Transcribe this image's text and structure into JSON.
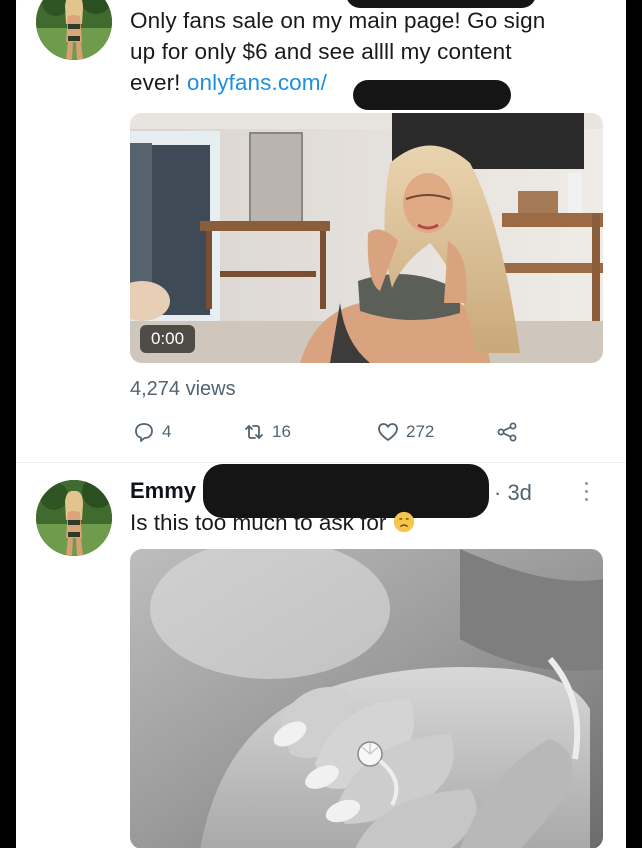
{
  "tweet1": {
    "text_line1": "Only fans sale on my main page! Go sign",
    "text_line2": "up for only $6 and see allll my content",
    "text_line3_prefix": "ever! ",
    "link": "onlyfans.com/",
    "video_duration": "0:00",
    "views": "4,274 views",
    "actions": {
      "reply_count": "4",
      "retweet_count": "16",
      "like_count": "272"
    }
  },
  "tweet2": {
    "author": "Emmy",
    "time": "· 3d",
    "text": "Is this too much to ask for ",
    "emoji": "disappointed-face"
  },
  "colors": {
    "link": "#1d8fe0",
    "secondary_text": "#536471",
    "redaction": "#151515",
    "background": "#000000",
    "card": "#ffffff"
  },
  "icons": [
    "reply-icon",
    "retweet-icon",
    "like-icon",
    "share-icon",
    "more-icon"
  ]
}
